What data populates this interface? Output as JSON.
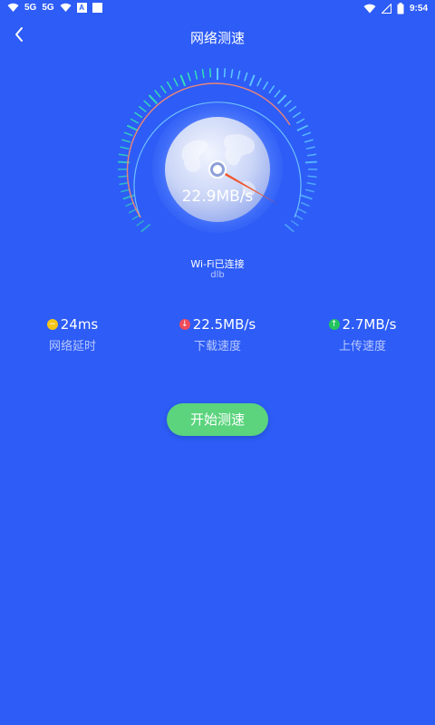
{
  "status_bar": {
    "network_1": "5G",
    "network_2": "5G",
    "app_icon_letter": "A",
    "time": "9:54"
  },
  "header": {
    "title": "网络测速"
  },
  "gauge": {
    "speed": "22.9MB/s"
  },
  "wifi": {
    "status": "Wi-Fi已连接",
    "name": "dlb"
  },
  "stats": {
    "latency": {
      "value": "24ms",
      "label": "网络延时"
    },
    "download": {
      "value": "22.5MB/s",
      "label": "下载速度"
    },
    "upload": {
      "value": "2.7MB/s",
      "label": "上传速度"
    }
  },
  "start_button": {
    "label": "开始测速"
  },
  "colors": {
    "background": "#2d5cf6",
    "latency_dot": "#f5c518",
    "download_dot": "#ef4c5a",
    "upload_dot": "#22c55e",
    "button": "#5bd47d",
    "needle": "#f0552c"
  },
  "icons": [
    "wifi-icon",
    "signal-icon",
    "battery-icon",
    "back-icon"
  ]
}
